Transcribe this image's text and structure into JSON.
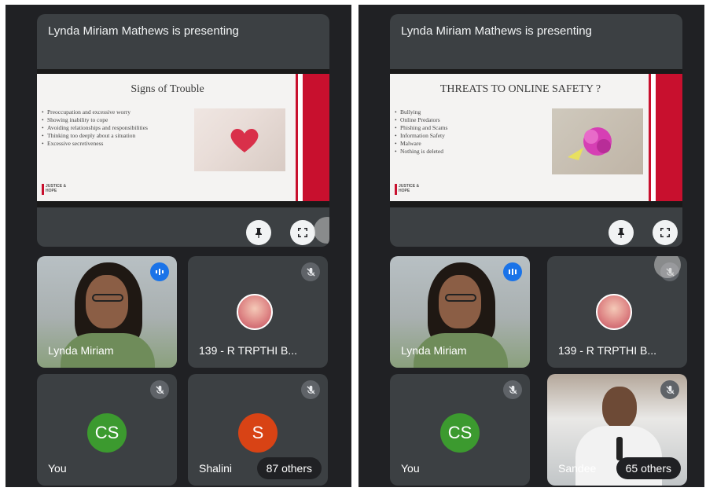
{
  "colors": {
    "panel_bg": "#202124",
    "tile_bg": "#3c4043",
    "avatar_cs": "#3c9a2f",
    "avatar_s": "#d84315",
    "speaking_blue": "#1a73e8",
    "slide_red": "#c8102e"
  },
  "left": {
    "presenting_label": "Lynda Miriam Mathews is presenting",
    "slide": {
      "title": "Signs of Trouble",
      "bullets": [
        "Preoccupation and excessive worry",
        "Showing inability to cope",
        "Avoiding relationships and responsibilities",
        "Thinking too deeply about a situation",
        "Excessive secretiveness"
      ],
      "logo": "JUSTICE & HOPE"
    },
    "controls": {
      "pin_icon": "pin-icon",
      "fullscreen_icon": "fullscreen-icon"
    },
    "tiles": [
      {
        "name": "Lynda Miriam",
        "type": "video",
        "status_icon": "speaking-icon"
      },
      {
        "name": "139 - R TRPTHI B...",
        "type": "photo",
        "status_icon": "mic-off-icon"
      },
      {
        "name": "You",
        "type": "initials",
        "initials": "CS",
        "status_icon": "mic-off-icon"
      },
      {
        "name": "Shalini",
        "type": "initials",
        "initials": "S",
        "status_icon": "mic-off-icon",
        "others": "87 others"
      }
    ]
  },
  "right": {
    "presenting_label": "Lynda Miriam Mathews is presenting",
    "slide": {
      "title": "THREATS TO ONLINE SAFETY ?",
      "bullets": [
        "Bullying",
        "Online Predators",
        "Phishing and Scams",
        "Information Safety",
        "Malware",
        "Nothing is deleted"
      ],
      "logo": "JUSTICE & HOPE"
    },
    "controls": {
      "pin_icon": "pin-icon",
      "fullscreen_icon": "fullscreen-icon"
    },
    "tiles": [
      {
        "name": "Lynda Miriam",
        "type": "video",
        "status_icon": "speaking-icon"
      },
      {
        "name": "139 - R TRPTHI B...",
        "type": "photo",
        "status_icon": "mic-off-icon"
      },
      {
        "name": "You",
        "type": "initials",
        "initials": "CS",
        "status_icon": "mic-off-icon"
      },
      {
        "name": "Sandee",
        "type": "video",
        "status_icon": "mic-off-icon",
        "others": "65 others"
      }
    ]
  }
}
